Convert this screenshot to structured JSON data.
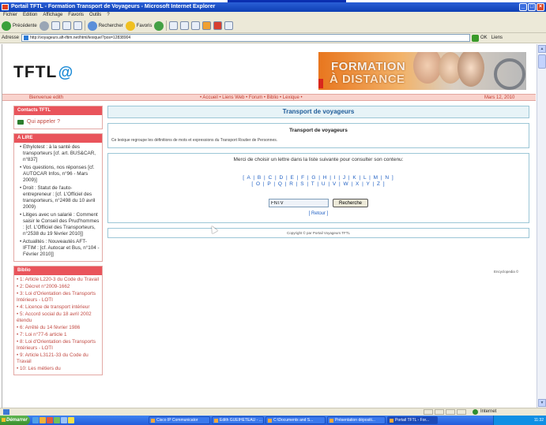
{
  "window": {
    "title": "Portail TFTL - Formation Transport de Voyageurs - Microsoft Internet Explorer",
    "controls": [
      "_",
      "□",
      "×"
    ]
  },
  "menu": [
    "Fichier",
    "Edition",
    "Affichage",
    "Favoris",
    "Outils",
    "?"
  ],
  "toolbar": {
    "back": "Précédente",
    "search": "Rechercher",
    "favorites": "Favoris"
  },
  "address": {
    "label": "Adresse",
    "url": "http://voyageurs.aft-iftim.net/html/lexique/?pos=12838904",
    "go": "OK",
    "links": "Liens"
  },
  "site": {
    "logo_text": "TFTL",
    "logo_at": "@",
    "banner_line1": "FORMATION",
    "banner_line2": "À DISTANCE",
    "welcome": "Bienvenue edith",
    "nav_links": "• Accueil  • Liens Web  • Forum  • Biblio  • Lexique  •",
    "date": "Mars 12, 2010"
  },
  "left": {
    "contacts_title": "Contacts TFTL",
    "contact_link": "Qui appeler ?",
    "libre_title": "A LIRE",
    "libre_items": [
      "• Ethylotest : à la santé des transporteurs [cf. art. BUS&CAR, n°837]",
      "• Vos questions, nos réponses [cf. AUTOCAR Infos, n°96 - Mars 2009)]",
      "• Droit : Statut de l'auto-entrepreneur : [cf. L'Officiel des transporteurs, n°2498 du 10 avril 2009)",
      "• Litiges avec un salarié : Comment saisir le Conseil des Prud'hommes : [cf. L'Officiel des Transporteurs, n°2538 du 19 février 2010]]",
      "• Actualités : Nouveautés AFT-IFTIM : [cf. Autocar et Bus, n°104 - Février 2010]]"
    ],
    "biblio_title": "Biblio",
    "biblio_items": [
      "• 1: Article L220-3 du Code du Travail",
      "• 2: Décret n°2009-1662",
      "• 3: Loi d'Orientation des Transports Intérieurs - LOTI",
      "• 4: Licence de transport intérieur",
      "• 5: Accord social du 18 avril 2002 étendu",
      "• 6: Arrêté du 14 février 1986",
      "• 7: Loi n°77-6 article 1",
      "• 8: Loi d'Orientation des Transports Intérieurs - LOTI",
      "• 9: Article L3121-33 du Code du Travail",
      "• 10: Les métiers du"
    ]
  },
  "main": {
    "page_title": "Transport de voyageurs",
    "lexique_title": "Transport de voyageurs",
    "lexique_desc": "Ce lexique regroupe les définitions de mots et expressions du Transport Routier de Personnes.",
    "choose_text": "Merci de choisir un lettre dans la liste suivante pour consulter son contenu:",
    "letters_row1": "[ A | B | C | D | E | F | G | H | I | J | K | L | M | N ]",
    "letters_row2": "[ O | P | Q | R | S | T | U | V | W | X | Y | Z ]",
    "search_value": "FNTV",
    "search_button": "Recherche",
    "retour": "[ Retour ]",
    "copyright": "Copyright © par Portail Voyageurs TFTL",
    "encyclo": "Encyclopedia ©"
  },
  "status": {
    "zone": "Internet"
  },
  "taskbar": {
    "start": "Démarrer",
    "tasks": [
      "Cisco IP Communicator",
      "Edith GUEIHETEAU - ...",
      "C:\\Documents and S...",
      "Présentation dépositi...",
      "Portail TFTL - For..."
    ],
    "clock": "11:32"
  }
}
